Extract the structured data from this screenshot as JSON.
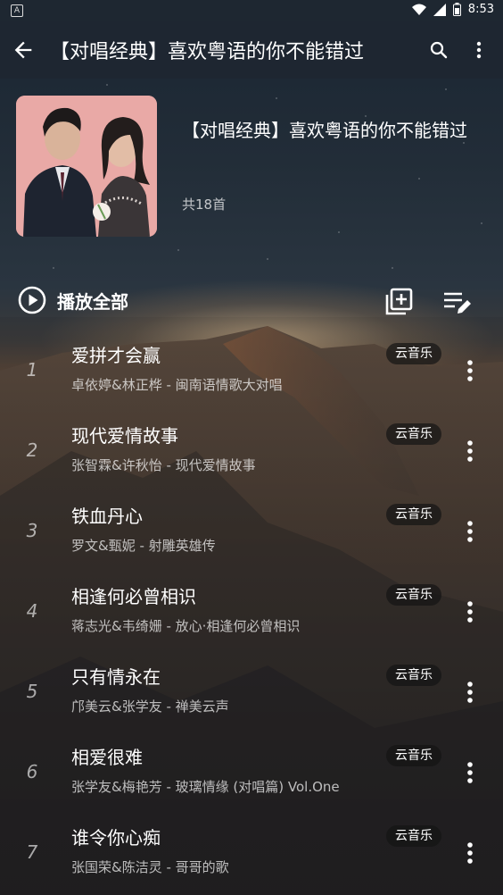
{
  "status_bar": {
    "time": "8:53",
    "notification_glyph": "A"
  },
  "app_bar": {
    "title": "【对唱经典】喜欢粤语的你不能错过"
  },
  "playlist": {
    "title": "【对唱经典】喜欢粤语的你不能错过",
    "count": "共18首"
  },
  "toolbar": {
    "play_all_label": "播放全部"
  },
  "songs": [
    {
      "index": "1",
      "title": "爱拼才会赢",
      "subtitle": "卓依婷&林正桦 - 闽南语情歌大对唱",
      "badge": "云音乐"
    },
    {
      "index": "2",
      "title": "现代爱情故事",
      "subtitle": "张智霖&许秋怡 - 现代爱情故事",
      "badge": "云音乐"
    },
    {
      "index": "3",
      "title": "铁血丹心",
      "subtitle": "罗文&甄妮 - 射雕英雄传",
      "badge": "云音乐"
    },
    {
      "index": "4",
      "title": "相逢何必曾相识",
      "subtitle": "蒋志光&韦绮姗 - 放心·相逢何必曾相识",
      "badge": "云音乐"
    },
    {
      "index": "5",
      "title": "只有情永在",
      "subtitle": "邝美云&张学友 - 禅美云声",
      "badge": "云音乐"
    },
    {
      "index": "6",
      "title": "相爱很难",
      "subtitle": "张学友&梅艳芳 - 玻璃情缘 (对唱篇) Vol.One",
      "badge": "云音乐"
    },
    {
      "index": "7",
      "title": "谁令你心痴",
      "subtitle": "张国荣&陈洁灵 - 哥哥的歌",
      "badge": "云音乐"
    }
  ]
}
